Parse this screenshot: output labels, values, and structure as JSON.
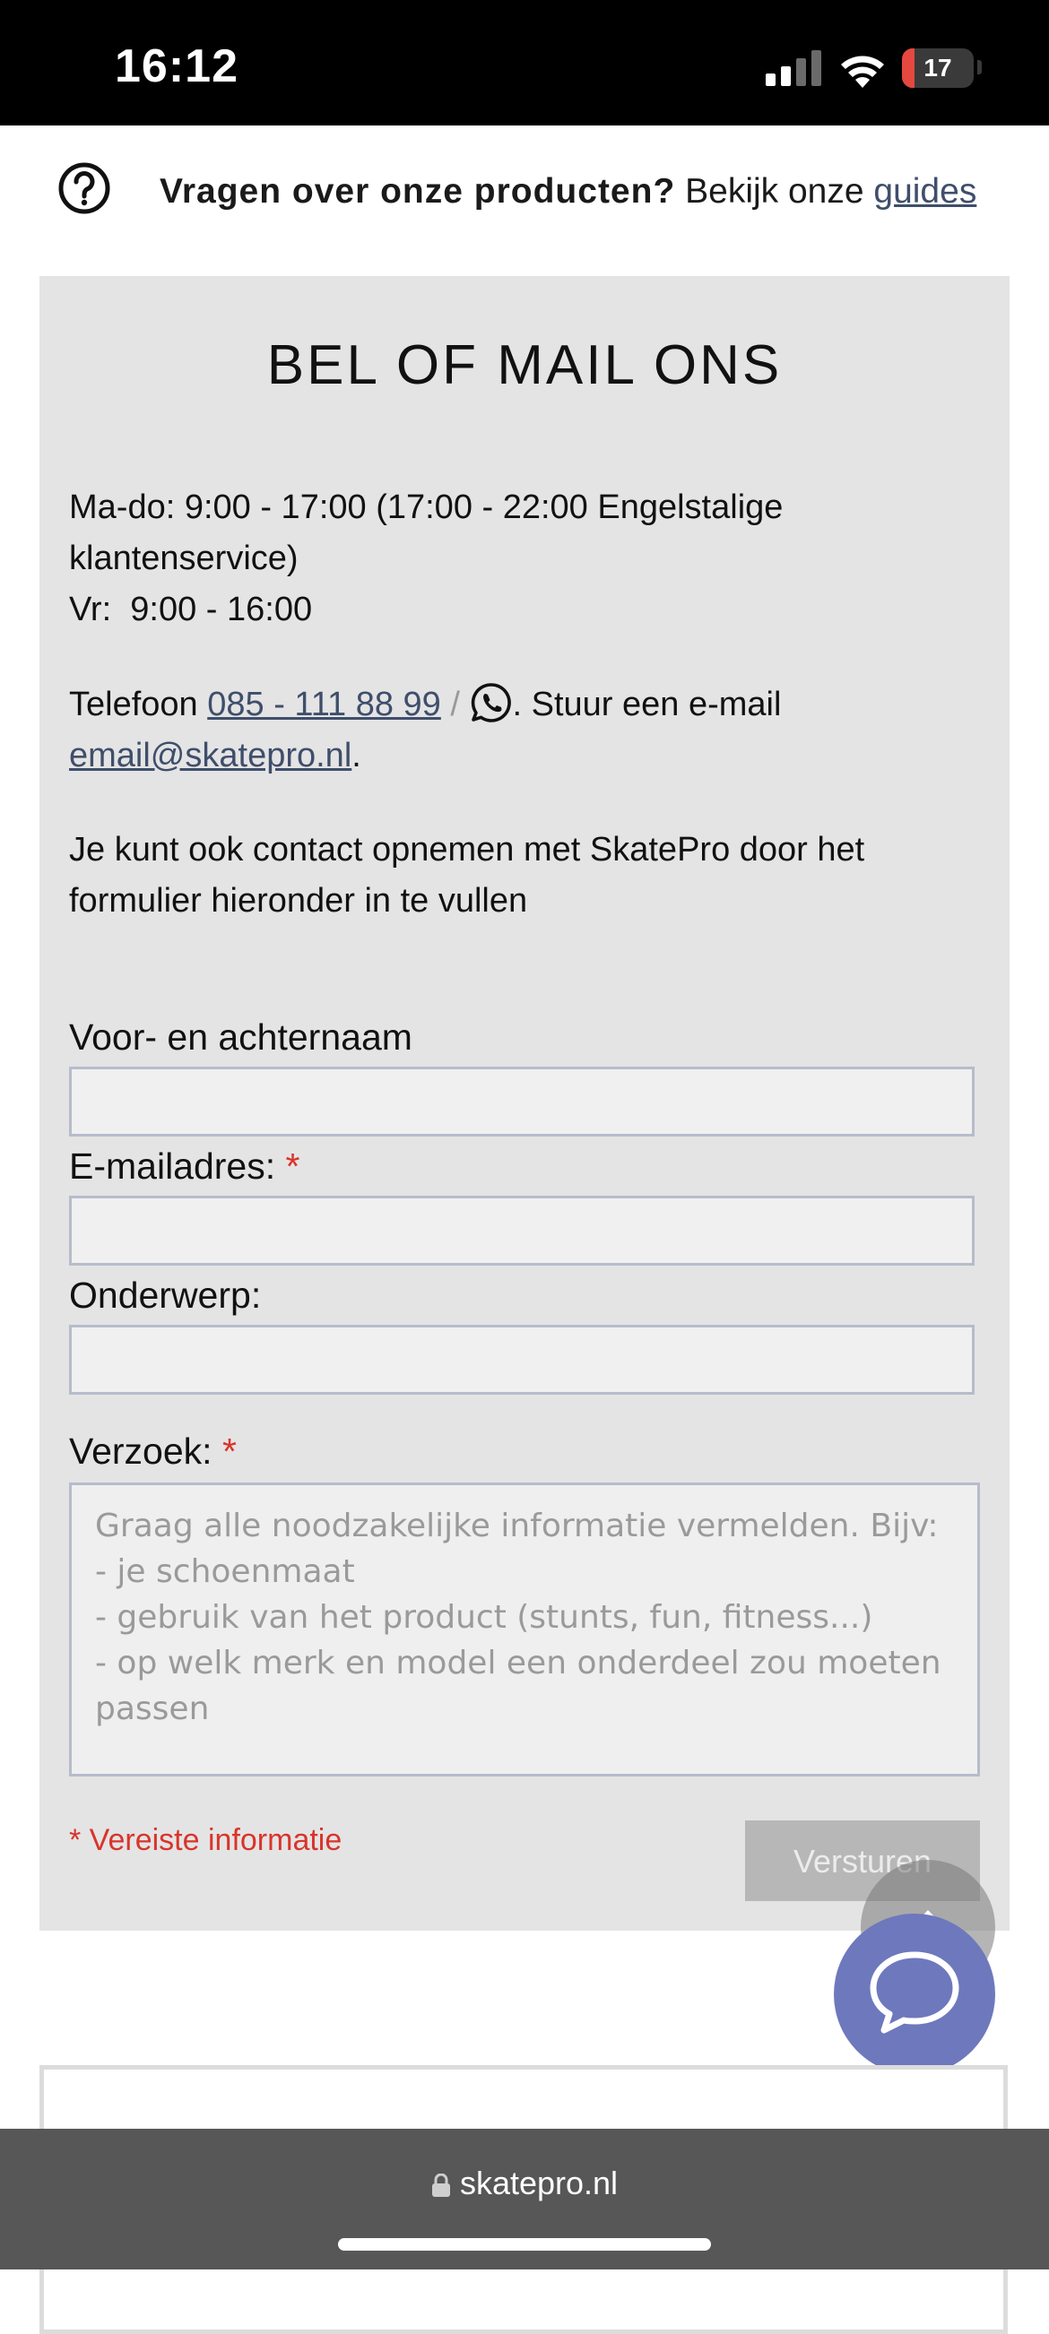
{
  "status_bar": {
    "time": "16:12",
    "battery": "17"
  },
  "help_bar": {
    "bold": "Vragen over onze producten?",
    "text": " Bekijk onze ",
    "link": "guides"
  },
  "contact": {
    "title": "BEL OF MAIL ONS",
    "hours_line1": "Ma-do: 9:00 - 17:00 (17:00 - 22:00 Engelstalige klantenservice)",
    "hours_line2": "Vr:  9:00 - 16:00",
    "phone_prefix": "Telefoon ",
    "phone": "085 - 111 88 99",
    "slash": " / ",
    "email_prefix": ". Stuur een e-mail",
    "email": "email@skatepro.nl",
    "email_suffix": ".",
    "form_intro": "Je kunt ook contact opnemen met SkatePro door het formulier hieronder in te vullen"
  },
  "form": {
    "name_label": "Voor- en achternaam",
    "email_label": "E-mailadres:",
    "subject_label": "Onderwerp:",
    "request_label": "Verzoek:",
    "required_mark": "*",
    "request_placeholder": "Graag alle noodzakelijke informatie vermelden. Bijv:\n- je schoenmaat\n- gebruik van het product (stunts, fun, fitness...)\n- op welk merk en model een onderdeel zou moeten passen",
    "required_note": "* Vereiste informatie",
    "submit": "Versturen"
  },
  "browser": {
    "url": "skatepro.nl"
  },
  "colors": {
    "accent_link": "#3f4e6b",
    "required": "#d9342b",
    "chat": "#6e78bd",
    "panel": "#e4e4e4"
  }
}
